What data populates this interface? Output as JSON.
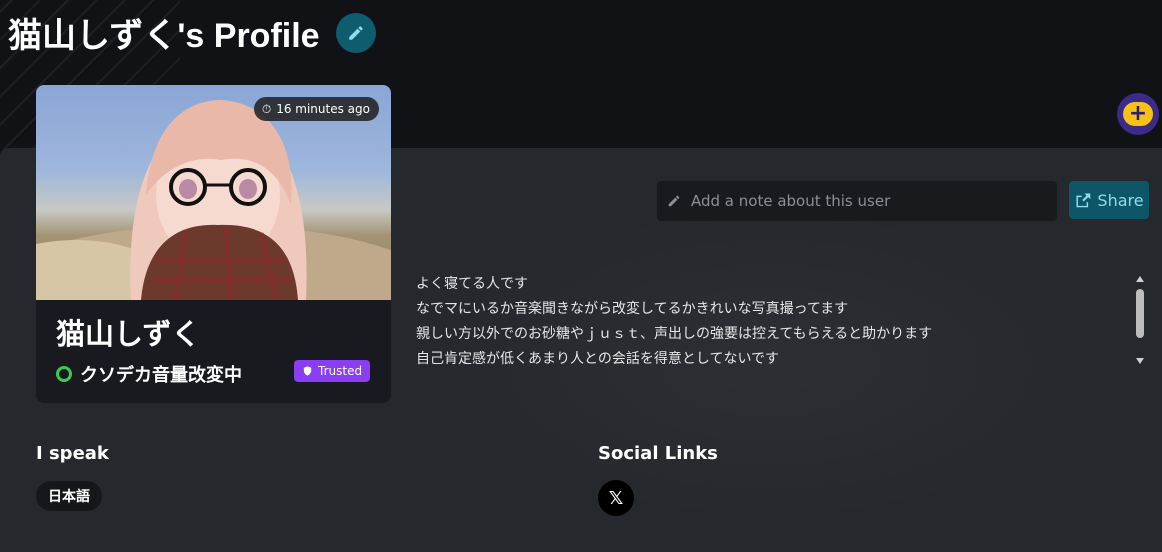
{
  "header": {
    "title": "猫山しずく's Profile",
    "edit_icon": "pencil-icon"
  },
  "fab": {
    "icon": "chat-plus-icon",
    "color": "#f6c21a"
  },
  "profile_card": {
    "last_seen": "16 minutes ago",
    "display_name": "猫山しずく",
    "status_text": "クソデカ音量改変中",
    "status_color": "#3ec94f",
    "trust_badge": "Trusted",
    "trust_color": "#8a3ef2"
  },
  "note": {
    "placeholder": "Add a note about this user",
    "value": ""
  },
  "share": {
    "label": "Share",
    "icon": "share-icon"
  },
  "bio": {
    "lines": [
      "よく寝てる人です",
      "なでマにいるか音楽聞きながら改変してるかきれいな写真撮ってます",
      "親しい方以外でのお砂糖やｊｕｓｔ、声出しの強要は控えてもらえると助かります",
      "自己肯定感が低くあまり人との会話を得意としてないです"
    ]
  },
  "languages": {
    "heading": "I speak",
    "items": [
      "日本語"
    ]
  },
  "social": {
    "heading": "Social Links",
    "items": [
      {
        "icon": "x-logo-icon",
        "glyph": "𝕏"
      }
    ]
  }
}
